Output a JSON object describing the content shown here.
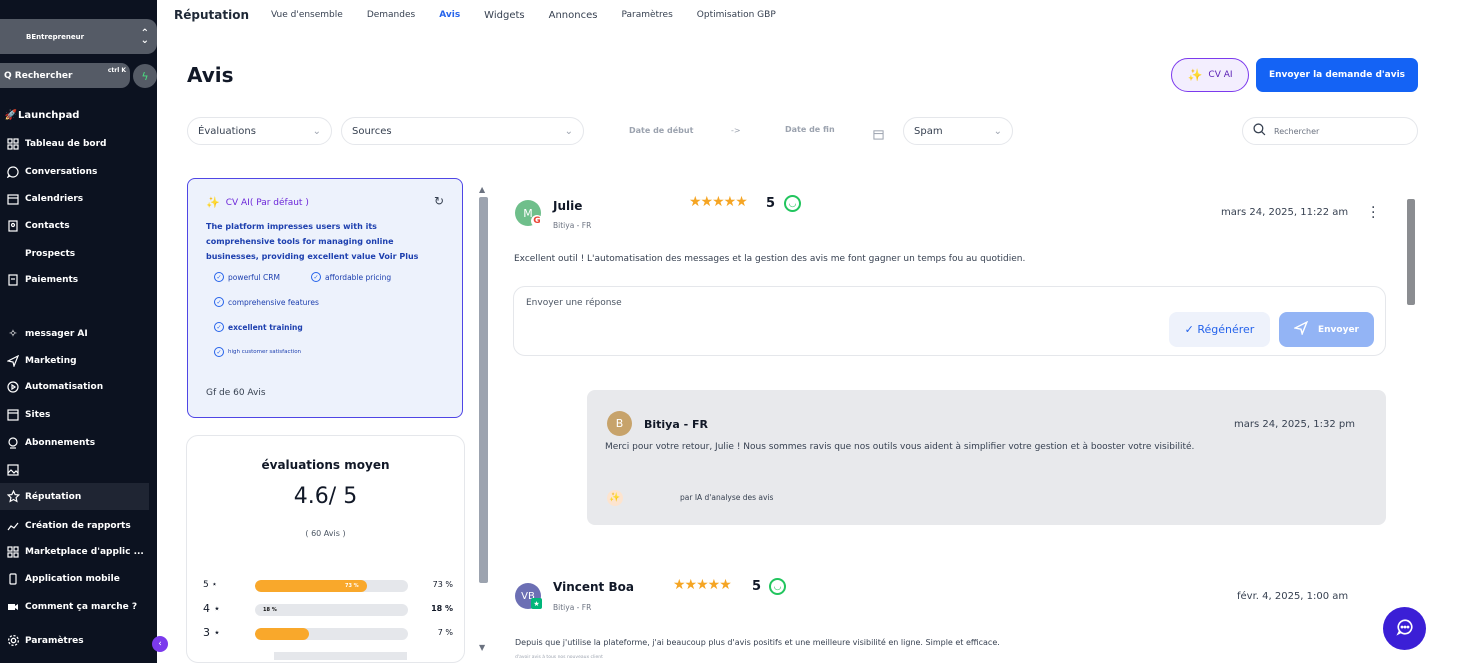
{
  "sidebar": {
    "account": "BEntrepreneur",
    "search_label": "Q Rechercher",
    "search_shortcut": "ctrl K",
    "items": [
      {
        "label": "Launchpad",
        "icon": "rocket-icon"
      },
      {
        "label": "Tableau de bord",
        "icon": "grid-icon"
      },
      {
        "label": "Conversations",
        "icon": "chat-icon"
      },
      {
        "label": "Calendriers",
        "icon": "calendar-icon"
      },
      {
        "label": "Contacts",
        "icon": "contacts-icon"
      },
      {
        "label": "Prospects",
        "icon": ""
      },
      {
        "label": "Paiements",
        "icon": "payment-icon"
      },
      {
        "label": "messager AI",
        "icon": "sparkle-icon"
      },
      {
        "label": "Marketing",
        "icon": "send-icon"
      },
      {
        "label": "Automatisation",
        "icon": "automation-icon"
      },
      {
        "label": "Sites",
        "icon": "sites-icon"
      },
      {
        "label": "Abonnements",
        "icon": "membership-icon"
      },
      {
        "label": "",
        "icon": "media-icon"
      },
      {
        "label": "Réputation",
        "icon": "star-icon"
      },
      {
        "label": "Création de rapports",
        "icon": "chart-icon"
      },
      {
        "label": "Marketplace d'applic ...",
        "icon": "apps-icon"
      },
      {
        "label": "Application mobile",
        "icon": "mobile-icon"
      },
      {
        "label": "Comment ça marche ?",
        "icon": "video-icon"
      },
      {
        "label": "Paramètres",
        "icon": "gear-icon"
      }
    ]
  },
  "topnav": {
    "brand": "Réputation",
    "tabs": [
      "Vue d'ensemble",
      "Demandes",
      "Avis",
      "Widgets",
      "Annonces",
      "Paramètres",
      "Optimisation GBP"
    ],
    "active": "Avis"
  },
  "page": {
    "title": "Avis",
    "ai_button": "CV AI",
    "send_request_button": "Envoyer la demande d'avis"
  },
  "filters": {
    "evaluations": "Évaluations",
    "sources": "Sources",
    "date_start": "Date de début",
    "date_arrow": "->",
    "date_end": "Date de fin",
    "spam": "Spam",
    "search_placeholder": "Rechercher"
  },
  "ai_summary": {
    "header": "CV AI( Par défaut )",
    "text": "The platform impresses users with its comprehensive tools for managing online businesses, providing excellent value Voir Plus",
    "tags": [
      "powerful CRM",
      "affordable pricing",
      "comprehensive features",
      "excellent training",
      "high customer satisfaction"
    ],
    "count": "Gf de 60 Avis"
  },
  "average": {
    "title": "évaluations moyen",
    "value": "4.6/ 5",
    "count": "( 60 Avis )",
    "rows": [
      {
        "label": "5 ⋆",
        "fraction": 0.73,
        "inner": "73 %",
        "pct": "73 %"
      },
      {
        "label": "4 ⋆",
        "fraction": 0.18,
        "inner": "18 %",
        "pct": "18 %"
      },
      {
        "label": "3 ⋆",
        "fraction": 0.07,
        "inner": "",
        "pct": "7 %"
      }
    ]
  },
  "reviews": [
    {
      "initial": "M",
      "name": "Julie",
      "source": "Bitiya - FR",
      "stars": "★★★★★",
      "score": "5",
      "date": "mars 24, 2025, 11:22 am",
      "text": "Excellent outil ! L'automatisation des messages et la gestion des avis me font gagner un temps fou au quotidien.",
      "reply_placeholder": "Envoyer une réponse",
      "regen_label": "✓ Régénérer",
      "send_label": "Envoyer"
    },
    {
      "initial": "VB",
      "name": "Vincent Boa",
      "source": "Bitiya - FR",
      "stars": "★★★★★",
      "score": "5",
      "date": "févr. 4, 2025, 1:00 am",
      "text": "Depuis que j'utilise la plateforme, j'ai beaucoup plus d'avis positifs et une meilleure visibilité en ligne. Simple et efficace.",
      "subtext": "d'avoir avis à tous nos nouveaux client"
    }
  ],
  "response": {
    "initial": "B",
    "name": "Bitiya - FR",
    "date": "mars 24, 2025, 1:32 pm",
    "text": "Merci pour votre retour, Julie ! Nous sommes ravis que nos outils vous aident à simplifier votre gestion et à booster votre visibilité.",
    "footer": "par IA d'analyse des avis"
  },
  "colors": {
    "sidebar_bg": "#0c1220",
    "primary": "#1463f5",
    "star": "#f5a524",
    "bar": "#f9a82b",
    "ai_purple": "#7c3aed"
  }
}
